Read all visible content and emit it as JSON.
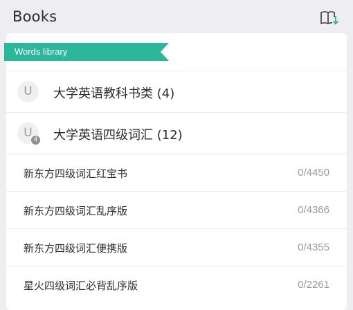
{
  "header": {
    "title": "Books",
    "icon": "book-download-icon"
  },
  "section": {
    "label": "Words library",
    "accent_color": "#2bb79a"
  },
  "categories": [
    {
      "avatar_letter": "U",
      "badge": "",
      "title": "大学英语教科书类 (4)"
    },
    {
      "avatar_letter": "U",
      "badge": "4",
      "title": "大学英语四级词汇 (12)"
    }
  ],
  "books": [
    {
      "name": "新东方四级词汇红宝书",
      "progress": "0/4450"
    },
    {
      "name": "新东方四级词汇乱序版",
      "progress": "0/4366"
    },
    {
      "name": "新东方四级词汇便携版",
      "progress": "0/4355"
    },
    {
      "name": "星火四级词汇必背乱序版",
      "progress": "0/2261"
    }
  ]
}
